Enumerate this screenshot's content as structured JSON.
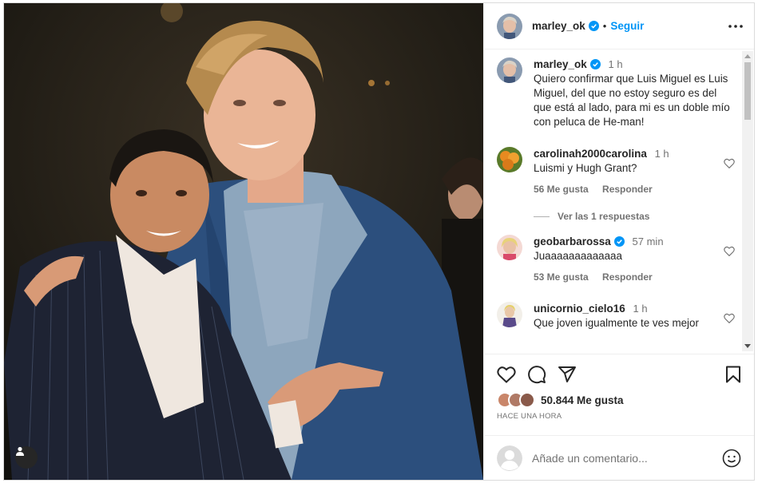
{
  "post": {
    "username": "marley_ok",
    "follow_label": "Seguir",
    "dot": "•",
    "caption_time": "1 h",
    "caption": "Quiero confirmar que Luis Miguel es Luis Miguel, del que no estoy seguro es del que está al lado, para mi es un doble mío con peluca de He-man!"
  },
  "comments": [
    {
      "username": "carolinah2000carolina",
      "time": "1 h",
      "text": "Luismi y Hugh Grant?",
      "likes": "56 Me gusta",
      "reply_label": "Responder",
      "avatar_color": "#d9832a"
    },
    {
      "username": "geobarbarossa",
      "time": "57 min",
      "text": "Juaaaaaaaaaaaaa",
      "likes": "53 Me gusta",
      "reply_label": "Responder",
      "avatar_color": "#e8b7b0"
    },
    {
      "username": "unicornio_cielo16",
      "time": "1 h",
      "text": "Que joven igualmente te ves mejor",
      "avatar_color": "#e2c9a5"
    }
  ],
  "view_replies": "Ver las 1 respuestas",
  "likes_total": "50.844 Me gusta",
  "posted_ago": "HACE UNA HORA",
  "add_comment_placeholder": "Añade un comentario...",
  "colors": {
    "accent": "#0095f6",
    "verified": "#0095f6",
    "text_secondary": "#737373"
  }
}
